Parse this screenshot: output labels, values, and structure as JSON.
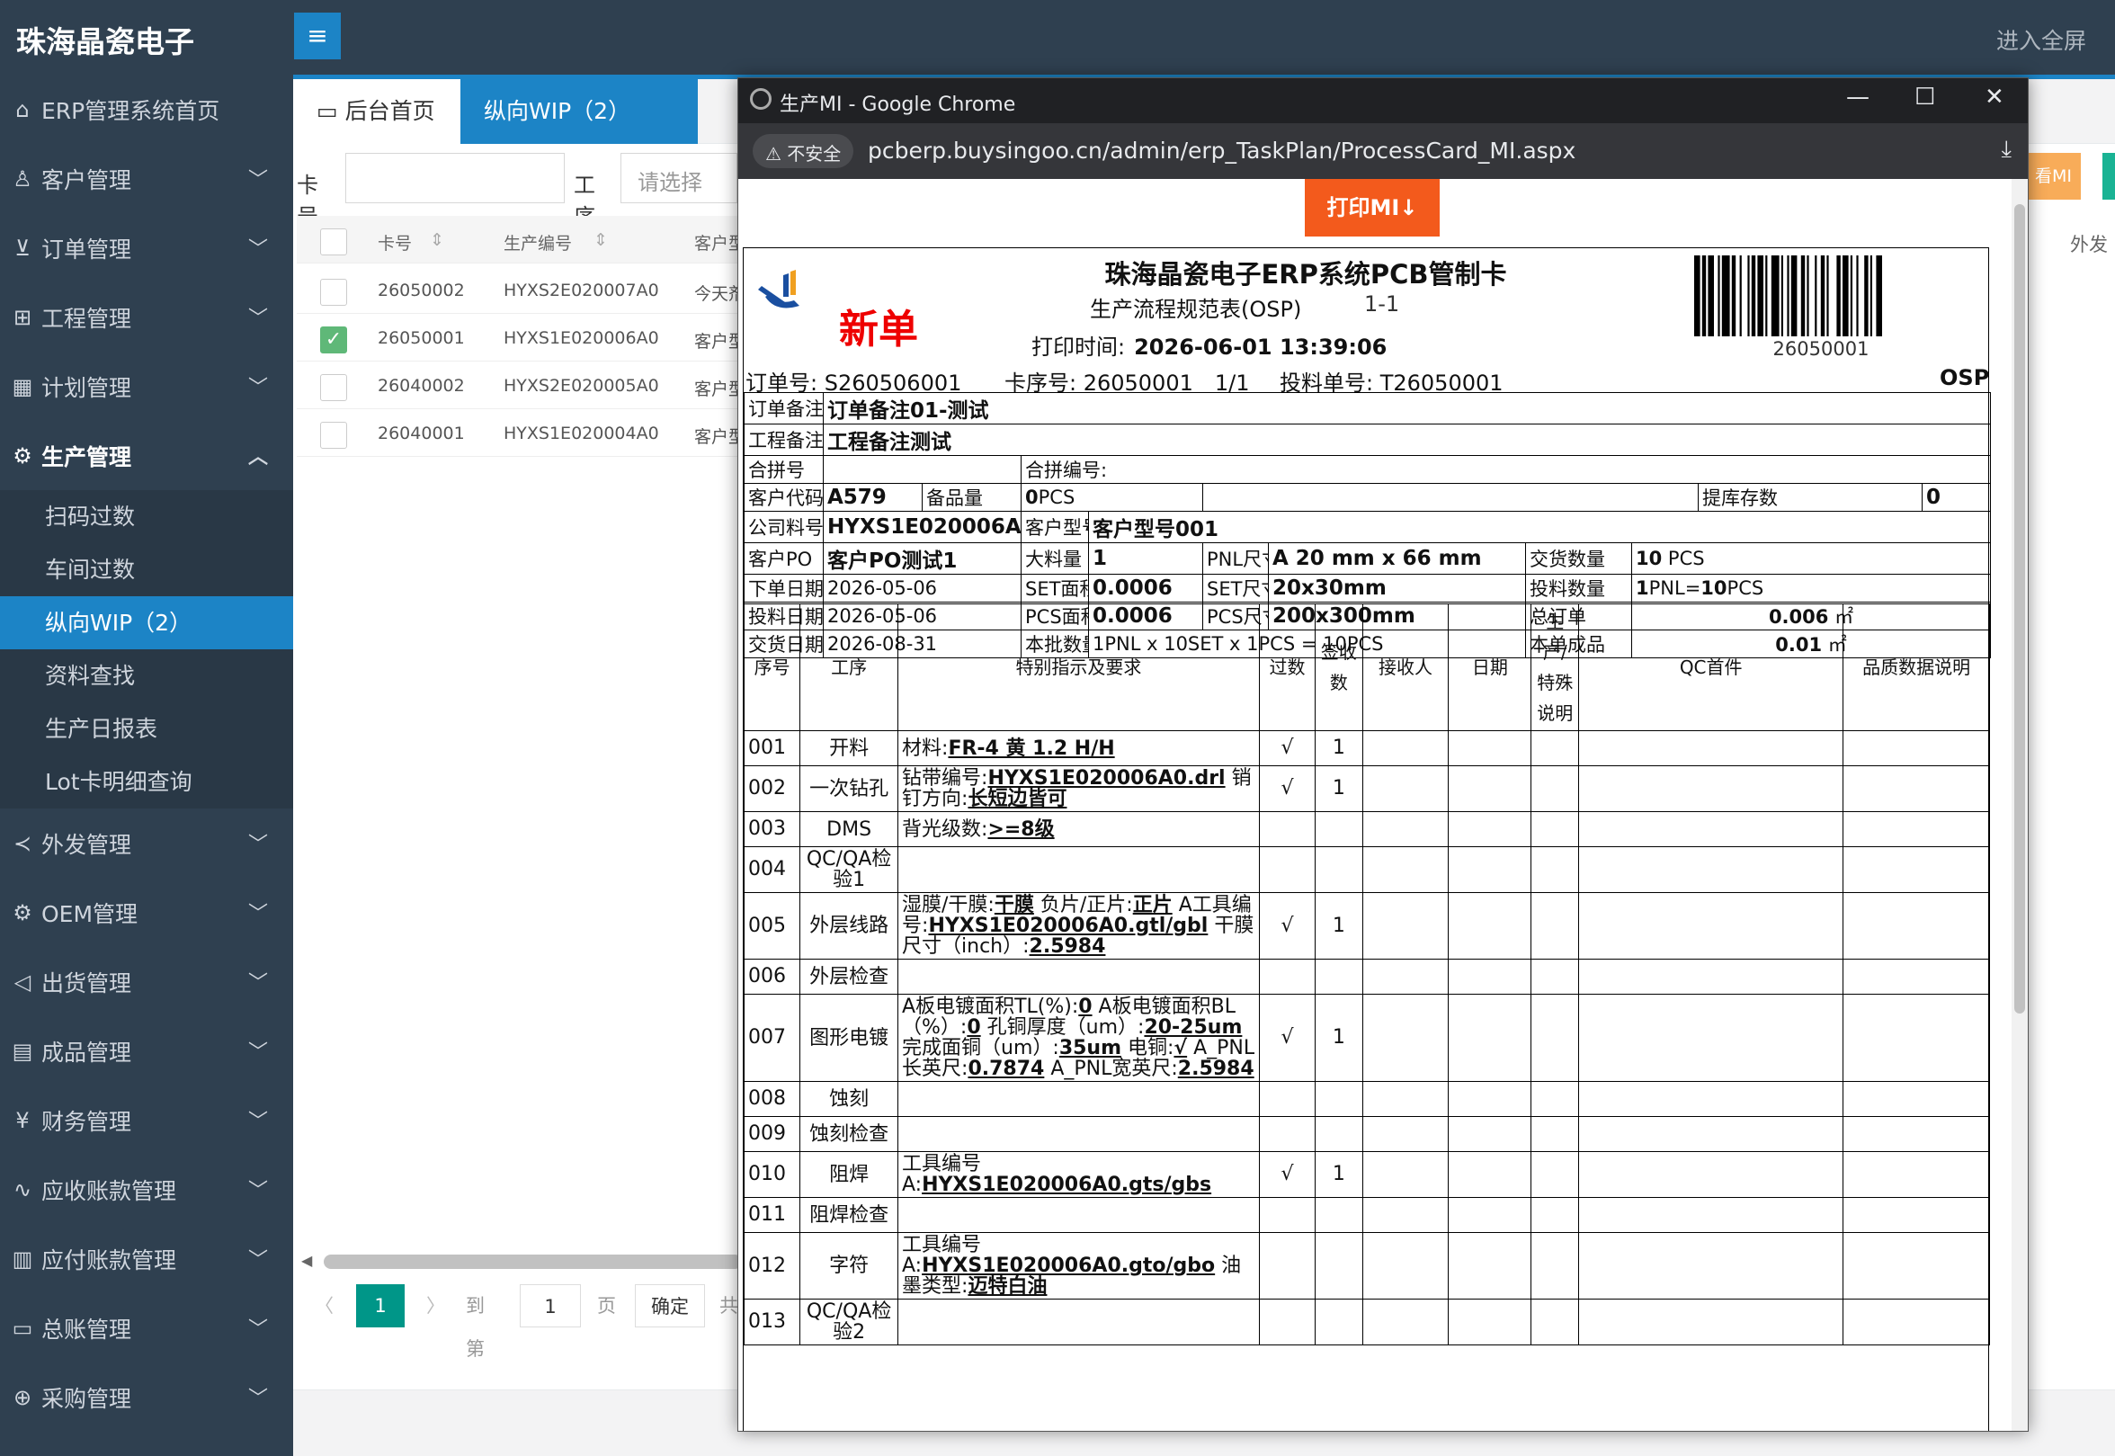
{
  "app": {
    "title": "珠海晶瓷电子",
    "fullscreen": "进入全屏"
  },
  "sidebar": {
    "home": "ERP管理系统首页",
    "groups": [
      "客户管理",
      "订单管理",
      "工程管理",
      "计划管理",
      "生产管理"
    ],
    "production_sub": [
      "扫码过数",
      "车间过数",
      "纵向WIP（2）",
      "资料查找",
      "生产日报表",
      "Lot卡明细查询"
    ],
    "groups2": [
      "外发管理",
      "OEM管理",
      "出货管理",
      "成品管理",
      "财务管理",
      "应收账款管理",
      "应付账款管理",
      "总账管理",
      "采购管理"
    ]
  },
  "tabs": {
    "home": "后台首页",
    "wip": "纵向WIP（2）",
    "close": "×"
  },
  "filter": {
    "card_label": "卡号",
    "process_label": "工序",
    "process_placeholder": "请选择"
  },
  "grid": {
    "headers": [
      "卡号",
      "生产编号",
      "客户型"
    ],
    "rows": [
      {
        "card": "26050002",
        "prod": "HYXS2E020007A0",
        "cust": "今天剂",
        "checked": false
      },
      {
        "card": "26050001",
        "prod": "HYXS1E020006A0",
        "cust": "客户型",
        "checked": true
      },
      {
        "card": "26040002",
        "prod": "HYXS2E020005A0",
        "cust": "客户型",
        "checked": false
      },
      {
        "card": "26040001",
        "prod": "HYXS1E020004A0",
        "cust": "客户型",
        "checked": false
      }
    ]
  },
  "pager": {
    "current": "1",
    "goto": "到第",
    "page_val": "1",
    "page": "页",
    "confirm": "确定",
    "total": "共"
  },
  "right": {
    "btn": "看MI",
    "col": "外发"
  },
  "popup": {
    "window_title": "生产MI - Google Chrome",
    "insecure": "不安全",
    "url": "pcberp.buysingoo.cn/admin/erp_TaskPlan/ProcessCard_MI.aspx",
    "print_btn": "打印MI↓",
    "card": {
      "badge": "新单",
      "title": "珠海晶瓷电子ERP系统PCB管制卡",
      "subtitle": "生产流程规范表(OSP)",
      "subtitle_no": "1-1",
      "print_time_label": "打印时间:",
      "print_time": "2026-06-01 13:39:06",
      "barcode_num": "26050001",
      "order_no": "订单号: S260506001",
      "seq_no": "卡序号: 26050001　1/1",
      "feed_no": "投料单号: T26050001",
      "surface": "OSP",
      "info": {
        "order_note_l": "订单备注",
        "order_note": "订单备注01-测试",
        "eng_note_l": "工程备注",
        "eng_note": "工程备注测试",
        "merge_l": "合拼号",
        "merge_no_l": "合拼编号:",
        "cust_code_l": "客户代码",
        "cust_code": "A579",
        "spare_l": "备品量",
        "spare": "0",
        "spare_unit": "PCS",
        "stock_l": "提库存数",
        "stock": "0",
        "part_l": "公司料号",
        "part": "HYXS1E020006A0",
        "model_l": "客户型号",
        "model": "客户型号001",
        "po_l": "客户PO",
        "po": "客户PO测试1",
        "bulk_l": "大料量",
        "bulk": "1",
        "pnl_l": "PNL尺寸",
        "pnl": "A 20 mm x 66 mm",
        "deliv_qty_l": "交货数量",
        "deliv_qty": "10",
        "deliv_unit": "PCS",
        "order_date_l": "下单日期",
        "order_date": "2026-05-06",
        "set_area_l": "SET面积",
        "set_area": "0.0006",
        "set_size_l": "SET尺寸",
        "set_size": "20x30mm",
        "feed_qty_l": "投料数量",
        "feed_qty_a": "1",
        "feed_qty_b": "PNL=",
        "feed_qty_c": "10",
        "feed_qty_d": "PCS",
        "feed_date_l": "投料日期",
        "feed_date": "2026-05-06",
        "pcs_area_l": "PCS面积",
        "pcs_area": "0.0006",
        "pcs_size_l": "PCS尺寸",
        "pcs_size": "200x300mm",
        "total_l": "总订单",
        "total": "0.006",
        "total_unit": "㎡",
        "deliv_date_l": "交货日期",
        "deliv_date": "2026-08-31",
        "batch_l": "本批数量",
        "batch": "1PNL x 10SET x 1PCS = 10PCS",
        "finished_l": "本单成品",
        "finished": "0.01",
        "finished_unit": "㎡"
      },
      "proc_headers": [
        "序号",
        "工序",
        "特别指示及要求",
        "过数",
        "签收数",
        "接收人",
        "日期",
        "生产/特殊说明",
        "QC首件",
        "品质数据说明"
      ],
      "procs": [
        {
          "no": "001",
          "name": "开料",
          "check": "√",
          "qty": "1",
          "parts": [
            [
              "材料:",
              ""
            ],
            [
              "FR-4 黄 1.2 H/H",
              "u"
            ]
          ]
        },
        {
          "no": "002",
          "name": "一次钻孔",
          "check": "√",
          "qty": "1",
          "parts": [
            [
              "钻带编号:",
              ""
            ],
            [
              "HYXS1E020006A0.drl",
              "u"
            ],
            [
              " 销钉方向:",
              ""
            ],
            [
              "长短边皆可",
              "u"
            ]
          ]
        },
        {
          "no": "003",
          "name": "DMS",
          "check": "",
          "qty": "",
          "parts": [
            [
              "背光级数:",
              ""
            ],
            [
              ">=8级",
              "u"
            ]
          ]
        },
        {
          "no": "004",
          "name": "QC/QA检验1",
          "check": "",
          "qty": "",
          "parts": []
        },
        {
          "no": "005",
          "name": "外层线路",
          "check": "√",
          "qty": "1",
          "parts": [
            [
              "湿膜/干膜:",
              ""
            ],
            [
              "干膜",
              "u"
            ],
            [
              " 负片/正片:",
              ""
            ],
            [
              "正片",
              "u"
            ],
            [
              " A工具编号:",
              ""
            ],
            [
              "HYXS1E020006A0.gtl/gbl",
              "u"
            ],
            [
              " 干膜尺寸（inch）:",
              ""
            ],
            [
              "2.5984",
              "u"
            ]
          ]
        },
        {
          "no": "006",
          "name": "外层检查",
          "check": "",
          "qty": "",
          "parts": []
        },
        {
          "no": "007",
          "name": "图形电镀",
          "check": "√",
          "qty": "1",
          "parts": [
            [
              "A板电镀面积TL(%):",
              ""
            ],
            [
              "0",
              "u"
            ],
            [
              " A板电镀面积BL（%）:",
              ""
            ],
            [
              "0",
              "u"
            ],
            [
              " 孔铜厚度（um）:",
              ""
            ],
            [
              "20-25um",
              "u"
            ],
            [
              " 完成面铜（um）:",
              ""
            ],
            [
              "35um",
              "u"
            ],
            [
              " 电铜:",
              ""
            ],
            [
              "√",
              "u"
            ],
            [
              " A_PNL长英尺:",
              ""
            ],
            [
              "0.7874",
              "u"
            ],
            [
              " A_PNL宽英尺:",
              ""
            ],
            [
              "2.5984",
              "u"
            ]
          ]
        },
        {
          "no": "008",
          "name": "蚀刻",
          "check": "",
          "qty": "",
          "parts": []
        },
        {
          "no": "009",
          "name": "蚀刻检查",
          "check": "",
          "qty": "",
          "parts": []
        },
        {
          "no": "010",
          "name": "阻焊",
          "check": "√",
          "qty": "1",
          "parts": [
            [
              "工具编号A:",
              ""
            ],
            [
              "HYXS1E020006A0.gts/gbs",
              "u"
            ]
          ]
        },
        {
          "no": "011",
          "name": "阻焊检查",
          "check": "",
          "qty": "",
          "parts": []
        },
        {
          "no": "012",
          "name": "字符",
          "check": "",
          "qty": "",
          "parts": [
            [
              "工具编号A:",
              ""
            ],
            [
              "HYXS1E020006A0.gto/gbo",
              "u"
            ],
            [
              " 油墨类型:",
              ""
            ],
            [
              "迈特白油",
              "u"
            ]
          ]
        },
        {
          "no": "013",
          "name": "QC/QA检验2",
          "check": "",
          "qty": "",
          "parts": []
        }
      ]
    }
  }
}
